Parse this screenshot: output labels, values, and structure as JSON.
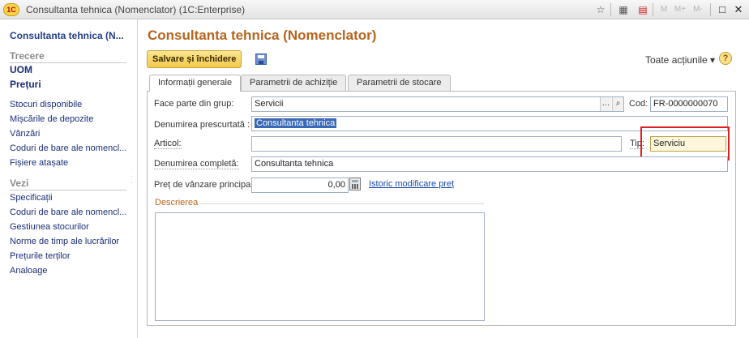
{
  "window": {
    "title": "Consultanta tehnica (Nomenclator)  (1C:Enterprise)",
    "logo_text": "1C",
    "toolbar_m": "M",
    "toolbar_mplus": "M+",
    "toolbar_mminus": "M-"
  },
  "sidebar": {
    "title": "Consultanta tehnica (N...",
    "trecere_header": "Trecere",
    "main_items": [
      "UOM",
      "Prețuri"
    ],
    "trecere_links": [
      "Stocuri disponibile",
      "Mișcările de depozite",
      "Vânzări",
      "Coduri de bare ale nomencl...",
      "Fișiere atașate"
    ],
    "vezi_header": "Vezi",
    "vezi_links": [
      "Specificații",
      "Coduri de bare ale nomencl...",
      "Gestiunea stocurilor",
      "Norme de timp ale lucrărilor",
      "Prețurile terților",
      "Analoage"
    ]
  },
  "form": {
    "title": "Consultanta tehnica (Nomenclator)",
    "save_close_label": "Salvare și închidere",
    "all_actions_label": "Toate acțiunile ▾",
    "help_label": "?",
    "tabs": [
      "Informații generale",
      "Parametrii de achiziție",
      "Parametrii de stocare"
    ],
    "group_label": "Face parte din grup:",
    "group_value": "Servicii",
    "code_label": "Cod:",
    "code_value": "FR-0000000070",
    "short_name_label": "Denumirea prescurtată :",
    "short_name_value": "Consultanta tehnica",
    "article_label": "Articol:",
    "article_value": "",
    "type_label": "Tip:",
    "type_value": "Serviciu",
    "full_name_label": "Denumirea completă:",
    "full_name_value": "Consultanta tehnica",
    "price_label": "Preț de vânzare principal:",
    "price_value": "0,00",
    "price_history_link": "Istoric modificare preț",
    "description_label": "Descrierea",
    "description_value": ""
  }
}
